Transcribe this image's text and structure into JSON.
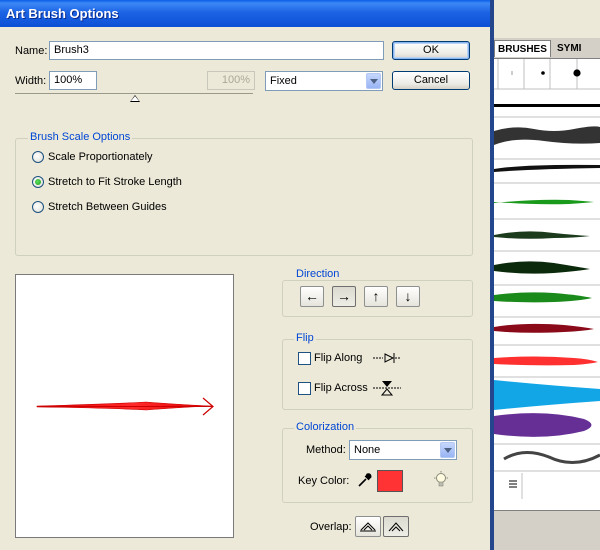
{
  "dialog": {
    "title": "Art Brush Options",
    "name_label": "Name:",
    "name_value": "Brush3",
    "width_label": "Width:",
    "width_value": "100%",
    "width_disabled_value": "100%",
    "width_mode": "Fixed",
    "ok_label": "OK",
    "cancel_label": "Cancel"
  },
  "scale_options": {
    "title": "Brush Scale Options",
    "items": [
      {
        "label": "Scale Proportionately",
        "selected": false
      },
      {
        "label": "Stretch to Fit Stroke Length",
        "selected": true
      },
      {
        "label": "Stretch Between Guides",
        "selected": false
      }
    ]
  },
  "direction": {
    "title": "Direction",
    "buttons": [
      {
        "glyph": "←",
        "icon": "arrow-left-icon",
        "active": false
      },
      {
        "glyph": "→",
        "icon": "arrow-right-icon",
        "active": true
      },
      {
        "glyph": "↑",
        "icon": "arrow-up-icon",
        "active": false
      },
      {
        "glyph": "↓",
        "icon": "arrow-down-icon",
        "active": false
      }
    ]
  },
  "flip": {
    "title": "Flip",
    "along_label": "Flip Along",
    "across_label": "Flip Across"
  },
  "colorization": {
    "title": "Colorization",
    "method_label": "Method:",
    "method_value": "None",
    "key_color_label": "Key Color:",
    "key_color": "#ff3333"
  },
  "overlap_label": "Overlap:",
  "brushes_panel": {
    "tabs": [
      "BRUSHES",
      "SYMI"
    ]
  },
  "colors": {
    "titlebar": "#0b4fd6",
    "dialog_bg": "#ece9d8",
    "group_title": "#0046d5",
    "preview_stroke": "#dd0000"
  }
}
